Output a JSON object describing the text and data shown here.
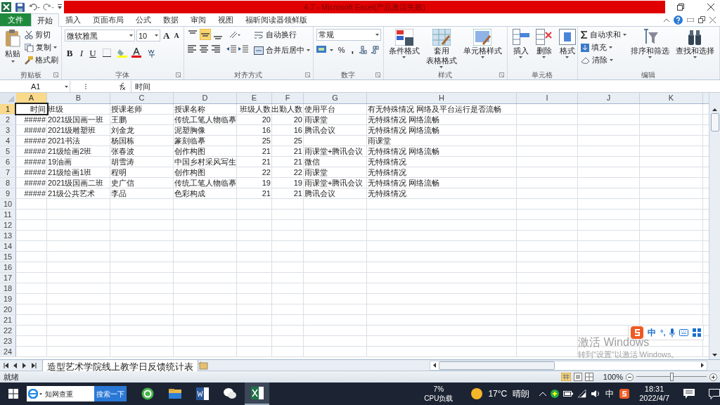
{
  "window": {
    "title": "4.7 - Microsoft Excel(产品激活失败)"
  },
  "ribbon_tabs": [
    {
      "label": "文件",
      "kind": "file",
      "selected": false
    },
    {
      "label": "开始",
      "kind": "tab",
      "selected": true
    },
    {
      "label": "插入",
      "kind": "tab",
      "selected": false
    },
    {
      "label": "页面布局",
      "kind": "tab",
      "selected": false
    },
    {
      "label": "公式",
      "kind": "tab",
      "selected": false
    },
    {
      "label": "数据",
      "kind": "tab",
      "selected": false
    },
    {
      "label": "审阅",
      "kind": "tab",
      "selected": false
    },
    {
      "label": "视图",
      "kind": "tab",
      "selected": false
    },
    {
      "label": "福昕阅读器领鲜版",
      "kind": "tab",
      "selected": false
    }
  ],
  "ribbon": {
    "clipboard": {
      "label": "剪贴板",
      "paste": "粘贴",
      "cut": "剪切",
      "copy": "复制",
      "format_painter": "格式刷"
    },
    "font": {
      "label": "字体",
      "font_name": "微软雅黑",
      "font_size": "10",
      "grow": "A",
      "shrink": "A",
      "bold": "B",
      "italic": "I",
      "underline": "U"
    },
    "alignment": {
      "label": "对齐方式",
      "vertical_align": [
        {
          "selected": false
        },
        {
          "selected": true
        },
        {
          "selected": false
        }
      ],
      "wrap_text": "自动换行",
      "merge_center": "合并后居中"
    },
    "number": {
      "label": "数字",
      "format": "常规",
      "percent": "%",
      "comma": ","
    },
    "styles": {
      "label": "样式",
      "buttons": [
        {
          "lines": [
            "条件格式"
          ]
        },
        {
          "lines": [
            "套用",
            "表格格式"
          ]
        },
        {
          "lines": [
            "单元格样式"
          ]
        }
      ]
    },
    "cells": {
      "label": "单元格",
      "buttons": [
        "插入",
        "删除",
        "格式"
      ]
    },
    "editing": {
      "label": "编辑",
      "autosum": "自动求和",
      "fill": "填充",
      "clear": "清除",
      "buttons": [
        "排序和筛选",
        "查找和选择"
      ]
    }
  },
  "formula_bar": {
    "name_box": "A1",
    "formula": "时间"
  },
  "sheet": {
    "columns": [
      {
        "letter": "A",
        "selected": true
      },
      {
        "letter": "B",
        "selected": false
      },
      {
        "letter": "C",
        "selected": false
      },
      {
        "letter": "D",
        "selected": false
      },
      {
        "letter": "E",
        "selected": false
      },
      {
        "letter": "F",
        "selected": false
      },
      {
        "letter": "G",
        "selected": false
      },
      {
        "letter": "H",
        "selected": false
      },
      {
        "letter": "I",
        "selected": false
      },
      {
        "letter": "J",
        "selected": false
      },
      {
        "letter": "K",
        "selected": false
      }
    ],
    "rows": [
      {
        "number": "1",
        "selected": true,
        "cells": [
          "时间",
          "班级",
          "授课老师",
          "授课名称",
          "班级人数",
          "出勤人数",
          "使用平台",
          "有无特殊情况 网络及平台运行是否流畅"
        ]
      },
      {
        "number": "2",
        "selected": false,
        "cells": [
          "#####",
          "2021级国画一班",
          "王鹏",
          "传统工笔人物临摹",
          "20",
          "20",
          "雨课堂",
          "无特殊情况 网络流畅"
        ]
      },
      {
        "number": "3",
        "selected": false,
        "cells": [
          "#####",
          "2021级雕塑班",
          "刘金龙",
          "泥塑胸像",
          "16",
          "16",
          "腾讯会议",
          "无特殊情况 网络流畅"
        ]
      },
      {
        "number": "4",
        "selected": false,
        "cells": [
          "#####",
          "2021书法",
          "杨国栋",
          "篆刻临摹",
          "25",
          "25",
          null,
          "雨课堂"
        ]
      },
      {
        "number": "5",
        "selected": false,
        "cells": [
          "#####",
          "21级绘画2班",
          "张春波",
          "创作构图",
          "21",
          "21",
          "雨课堂+腾讯会议",
          "无特殊情况 网络流畅"
        ]
      },
      {
        "number": "6",
        "selected": false,
        "cells": [
          "#####",
          "19油画",
          "胡雪涛",
          "中国乡村采风写生",
          "21",
          "21",
          "微信",
          "无特殊情况"
        ]
      },
      {
        "number": "7",
        "selected": false,
        "cells": [
          "#####",
          "21级绘画1班",
          "程明",
          "创作构图",
          "22",
          "22",
          "雨课堂",
          "无特殊情况"
        ]
      },
      {
        "number": "8",
        "selected": false,
        "cells": [
          "#####",
          "2021级国画二班",
          "史广信",
          "传统工笔人物临摹",
          "19",
          "19",
          "雨课堂+腾讯会议",
          "无特殊情况 网络流畅"
        ]
      },
      {
        "number": "9",
        "selected": false,
        "cells": [
          "#####",
          "21级公共艺术",
          "李品",
          "色彩构成",
          "21",
          "21",
          "腾讯会议",
          "无特殊情况"
        ]
      },
      {
        "number": "10",
        "selected": false
      },
      {
        "number": "11",
        "selected": false
      },
      {
        "number": "12",
        "selected": false
      },
      {
        "number": "13",
        "selected": false
      },
      {
        "number": "14",
        "selected": false
      },
      {
        "number": "15",
        "selected": false
      },
      {
        "number": "16",
        "selected": false
      },
      {
        "number": "17",
        "selected": false
      },
      {
        "number": "18",
        "selected": false
      },
      {
        "number": "19",
        "selected": false
      },
      {
        "number": "20",
        "selected": false
      },
      {
        "number": "21",
        "selected": false
      },
      {
        "number": "22",
        "selected": false
      },
      {
        "number": "23",
        "selected": false
      },
      {
        "number": "24",
        "selected": false
      }
    ]
  },
  "sheet_tabs": [
    {
      "label": "造型艺术学院线上教学日反馈统计表",
      "selected": true
    }
  ],
  "status_bar": {
    "status": "就绪",
    "zoom": "100%",
    "zoom_level": {
      "level": 0.5
    }
  },
  "ime_toolbar": {
    "mode": "中",
    "punctuation": "°,"
  },
  "activation_notice": {
    "title": "激活 Windows",
    "subtitle": "转到\"设置\"以激活 Windows。"
  },
  "taskbar": {
    "search_placeholder": "知网查重",
    "search_button": "搜索一下",
    "cpu_value": "7%",
    "cpu_label": "CPU负载",
    "temperature": "17°C",
    "weather": "晴朗",
    "input_mode": "中",
    "time": "18:31",
    "date": "2022/4/7"
  }
}
